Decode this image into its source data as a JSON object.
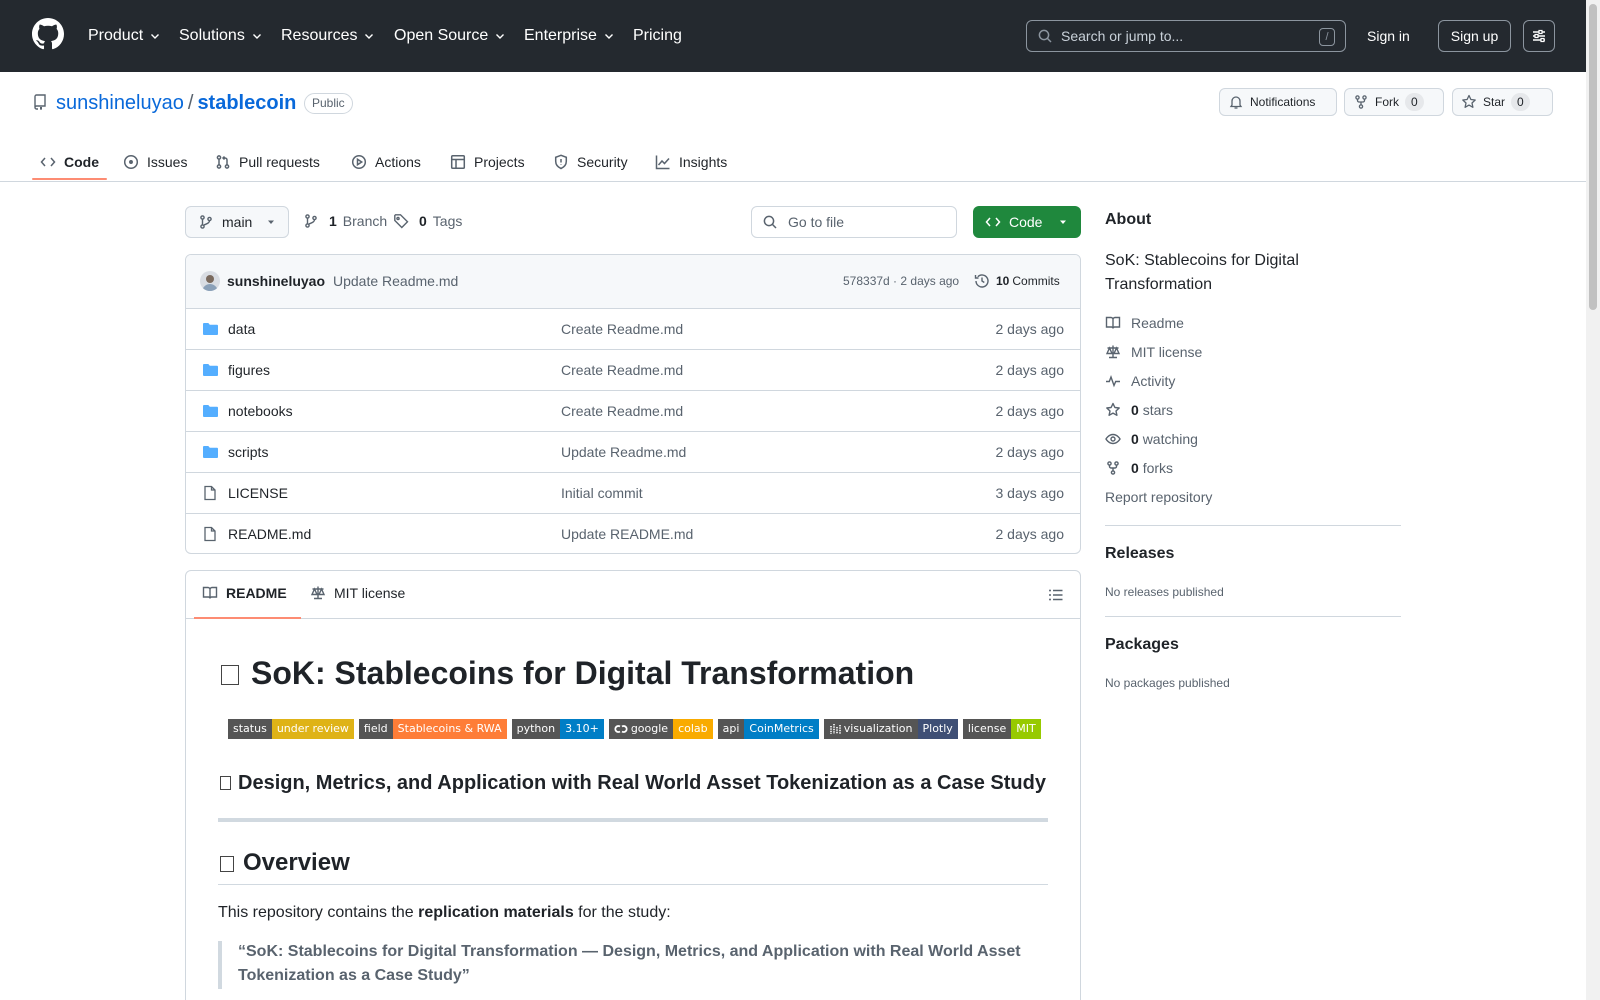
{
  "global_nav": {
    "items": [
      {
        "label": "Product"
      },
      {
        "label": "Solutions"
      },
      {
        "label": "Resources"
      },
      {
        "label": "Open Source"
      },
      {
        "label": "Enterprise"
      },
      {
        "label": "Pricing"
      }
    ],
    "search_placeholder": "Search or jump to...",
    "search_shortcut": "/",
    "sign_in": "Sign in",
    "sign_up": "Sign up"
  },
  "repo": {
    "owner": "sunshineluyao",
    "separator": "/",
    "name": "stablecoin",
    "visibility": "Public",
    "notifications_label": "Notifications",
    "fork_label": "Fork",
    "fork_count": "0",
    "star_label": "Star",
    "star_count": "0"
  },
  "repo_tabs": [
    {
      "label": "Code",
      "icon": "code-icon",
      "active": true
    },
    {
      "label": "Issues",
      "icon": "issue-icon"
    },
    {
      "label": "Pull requests",
      "icon": "pull-request-icon"
    },
    {
      "label": "Actions",
      "icon": "play-icon"
    },
    {
      "label": "Projects",
      "icon": "table-icon"
    },
    {
      "label": "Security",
      "icon": "shield-icon"
    },
    {
      "label": "Insights",
      "icon": "graph-icon"
    }
  ],
  "toolbar": {
    "branch": "main",
    "branch_count": "1",
    "branch_label": "Branch",
    "tag_count": "0",
    "tag_label": "Tags",
    "go_to_file": "Go to file",
    "code_button": "Code"
  },
  "latest_commit": {
    "author": "sunshineluyao",
    "message": "Update Readme.md",
    "hash_time": "578337d · 2 days ago",
    "commits_count": "10",
    "commits_label": "Commits"
  },
  "files": [
    {
      "name": "data",
      "type": "dir",
      "message": "Create Readme.md",
      "time": "2 days ago"
    },
    {
      "name": "figures",
      "type": "dir",
      "message": "Create Readme.md",
      "time": "2 days ago"
    },
    {
      "name": "notebooks",
      "type": "dir",
      "message": "Create Readme.md",
      "time": "2 days ago"
    },
    {
      "name": "scripts",
      "type": "dir",
      "message": "Update Readme.md",
      "time": "2 days ago"
    },
    {
      "name": "LICENSE",
      "type": "file",
      "message": "Initial commit",
      "time": "3 days ago"
    },
    {
      "name": "README.md",
      "type": "file",
      "message": "Update README.md",
      "time": "2 days ago"
    }
  ],
  "readme": {
    "tab_readme": "README",
    "tab_license": "MIT license",
    "title": "SoK: Stablecoins for Digital Transformation",
    "badges": [
      {
        "label": "status",
        "value": "under review",
        "color": "#dfb317"
      },
      {
        "label": "field",
        "value": "Stablecoins & RWA",
        "color": "#fe7d37"
      },
      {
        "label": "python",
        "value": "3.10+",
        "color": "#007ec6"
      },
      {
        "label": "google",
        "value": "colab",
        "color": "#f9ab00",
        "icon": "colab-icon"
      },
      {
        "label": "api",
        "value": "CoinMetrics",
        "color": "#007ec6"
      },
      {
        "label": "visualization",
        "value": "Plotly",
        "color": "#3f4f75",
        "icon": "plotly-icon"
      },
      {
        "label": "license",
        "value": "MIT",
        "color": "#97ca00"
      }
    ],
    "subtitle": "Design, Metrics, and Application with Real World Asset Tokenization as a Case Study",
    "overview_heading": "Overview",
    "para_before": "This repository contains the ",
    "para_bold": "replication materials",
    "para_after": " for the study:",
    "quote": "“SoK: Stablecoins for Digital Transformation — Design, Metrics, and Application with Real World Asset Tokenization as a Case Study”"
  },
  "about": {
    "heading": "About",
    "description": "SoK: Stablecoins for Digital Transformation",
    "readme": "Readme",
    "license": "MIT license",
    "activity": "Activity",
    "stars_count": "0",
    "stars_label": "stars",
    "watching_count": "0",
    "watching_label": "watching",
    "forks_count": "0",
    "forks_label": "forks",
    "report": "Report repository"
  },
  "releases": {
    "heading": "Releases",
    "empty": "No releases published"
  },
  "packages": {
    "heading": "Packages",
    "empty": "No packages published"
  },
  "colors": {
    "accent_link": "#0969da",
    "header_bg": "#24292f",
    "code_green": "#1f883d",
    "active_tab": "#fd8c73"
  }
}
